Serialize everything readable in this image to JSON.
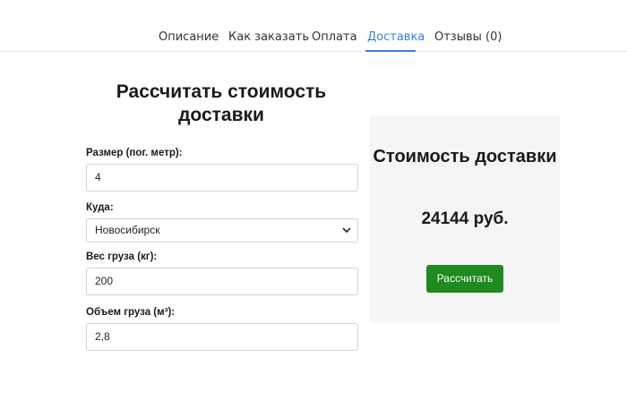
{
  "tabs": [
    {
      "label": "Описание",
      "active": false
    },
    {
      "label": "Как заказать",
      "active": false
    },
    {
      "label": "Оплата",
      "active": false
    },
    {
      "label": "Доставка",
      "active": true
    },
    {
      "label": "Отзывы (0)",
      "active": false
    }
  ],
  "form": {
    "title": "Рассчитать стоимость доставки",
    "size_label": "Размер (пог. метр):",
    "size_value": "4",
    "destination_label": "Куда:",
    "destination_value": "Новосибирск",
    "weight_label": "Вес груза (кг):",
    "weight_value": "200",
    "volume_label": "Объем груза (м³):",
    "volume_value": "2,8"
  },
  "result": {
    "title": "Стоимость доставки",
    "value": "24144 руб.",
    "button_label": "Рассчитать"
  },
  "colors": {
    "accent": "#3d7fe0",
    "button": "#1f8a1f",
    "panel": "#f5f5f5"
  },
  "icons": {
    "select_arrow": "chevron-down-icon"
  }
}
